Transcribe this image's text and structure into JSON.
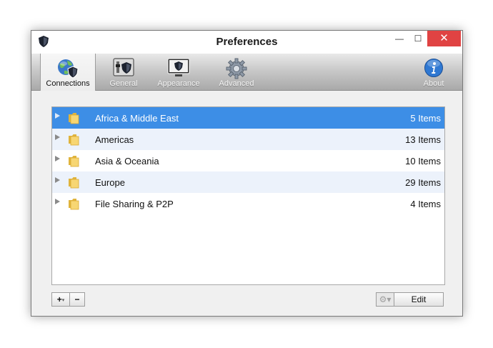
{
  "window": {
    "title": "Preferences",
    "controls": {
      "minimize": "—",
      "maximize": "☐",
      "close": "✕"
    }
  },
  "toolbar": {
    "items": [
      {
        "label": "Connections",
        "icon": "globe-shield-icon",
        "active": true
      },
      {
        "label": "General",
        "icon": "switch-shield-icon",
        "active": false
      },
      {
        "label": "Appearance",
        "icon": "monitor-shield-icon",
        "active": false
      },
      {
        "label": "Advanced",
        "icon": "gear-icon",
        "active": false
      },
      {
        "label": "About",
        "icon": "info-icon",
        "active": false
      }
    ]
  },
  "list": {
    "rows": [
      {
        "name": "Africa & Middle East",
        "count": "5 Items",
        "selected": true
      },
      {
        "name": "Americas",
        "count": "13 Items",
        "selected": false
      },
      {
        "name": "Asia & Oceania",
        "count": "10 Items",
        "selected": false
      },
      {
        "name": "Europe",
        "count": "29 Items",
        "selected": false
      },
      {
        "name": "File Sharing & P2P",
        "count": "4 Items",
        "selected": false
      }
    ]
  },
  "buttons": {
    "add": "+",
    "add_caret": "▾",
    "remove": "−",
    "gear": "⚙▾",
    "edit": "Edit"
  },
  "colors": {
    "selection": "#3d8ee6",
    "alt_row": "#ecf2fb",
    "close_button": "#e04343"
  }
}
